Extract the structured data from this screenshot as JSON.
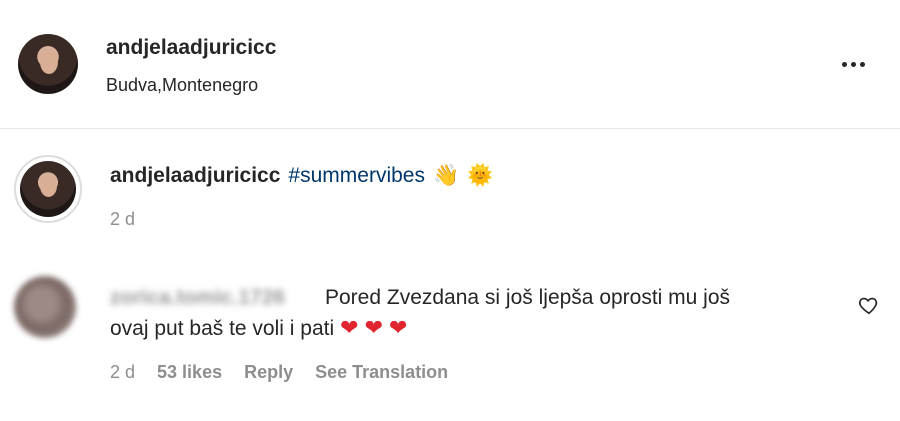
{
  "post_header": {
    "username": "andjelaadjuricicc",
    "location": "Budva,Montenegro",
    "more_icon": "more-horizontal-icon"
  },
  "caption": {
    "username": "andjelaadjuricicc",
    "hashtag": "#summervibes",
    "emoji_1": "👋",
    "emoji_2": "🌞",
    "time": "2 d"
  },
  "comment": {
    "username": "zorica.tomic.1726",
    "text_line_1": "Pored Zvezdana si još ljepša oprosti mu još",
    "text_line_2": "ovaj put baš te voli i pati",
    "hearts": [
      "❤",
      "❤",
      "❤"
    ],
    "time": "2 d",
    "likes": "53 likes",
    "reply_label": "Reply",
    "translate_label": "See Translation",
    "like_icon": "heart-outline-icon"
  },
  "colors": {
    "text": "#262626",
    "secondary": "#8e8e8e",
    "hashtag": "#00376b",
    "divider": "#e6e6e6",
    "heart": "#e0252f"
  }
}
